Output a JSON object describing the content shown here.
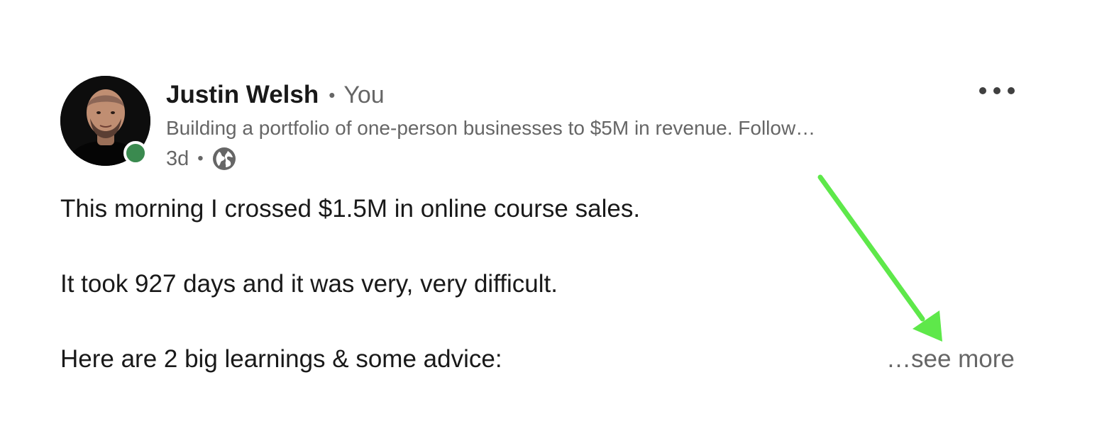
{
  "post": {
    "author": {
      "name": "Justin Welsh",
      "separator": "•",
      "relation": "You",
      "headline": "Building a portfolio of one-person businesses to $5M in revenue. Follow…"
    },
    "meta": {
      "timestamp": "3d",
      "separator": "•",
      "visibility_icon": "globe-icon"
    },
    "body_lines": [
      "This morning I crossed $1.5M in online course sales.",
      "It took 927 days and it was very, very difficult.",
      "Here are 2 big learnings & some advice:"
    ],
    "see_more_label": "…see more",
    "menu_icon": "more-options-icon"
  },
  "colors": {
    "text_primary": "#191919",
    "text_secondary": "#666666",
    "presence_green": "#3a8a4f",
    "annotation_arrow": "#5ee84a"
  }
}
